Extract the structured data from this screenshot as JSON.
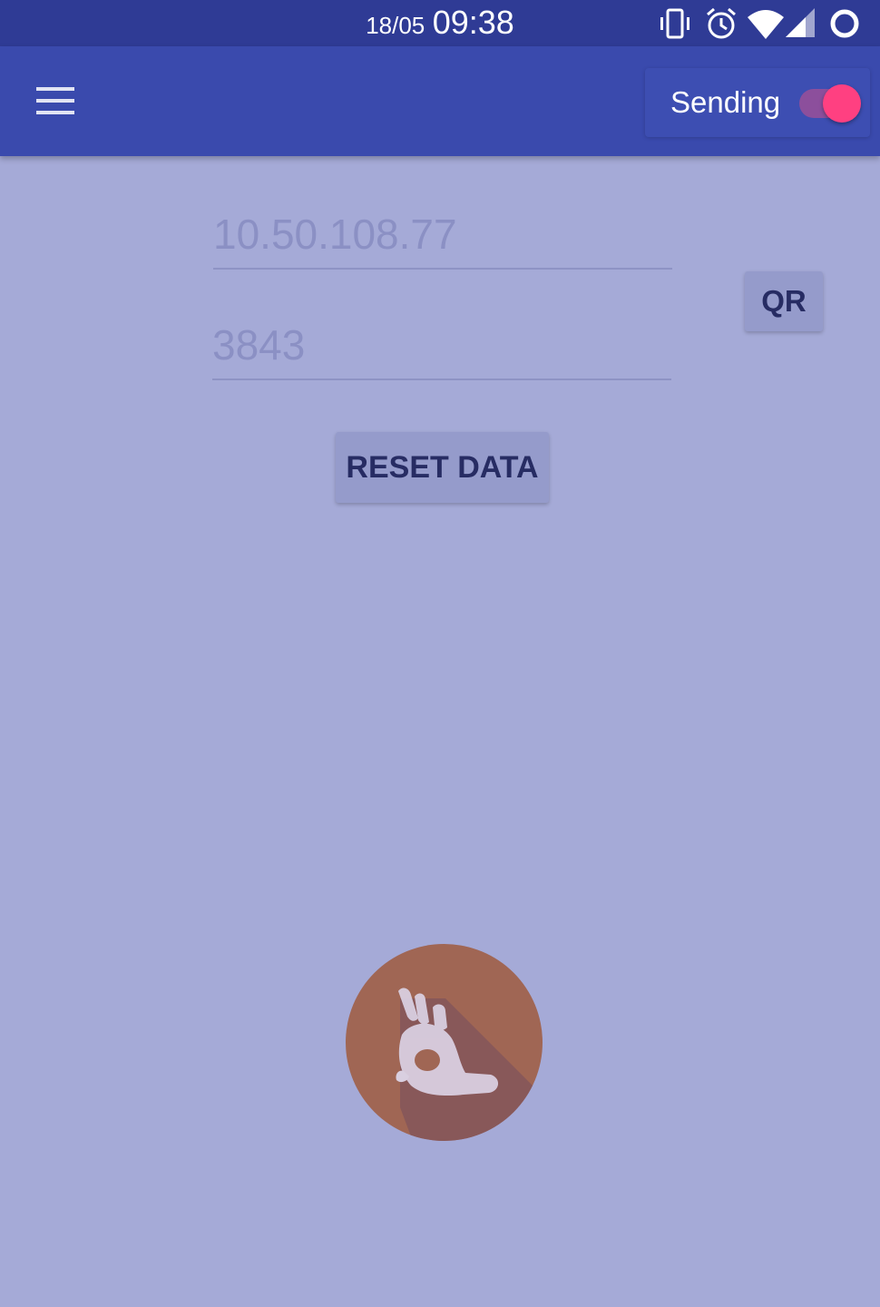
{
  "status_bar": {
    "date": "18/05",
    "time": "09:38",
    "icons": [
      "vibrate-icon",
      "alarm-icon",
      "wifi-icon",
      "cell-signal-icon",
      "battery-ring-icon"
    ]
  },
  "app_bar": {
    "menu_icon": "menu-icon",
    "sending_label": "Sending",
    "sending_enabled": true
  },
  "form": {
    "ip_address": "10.50.108.77",
    "port": "3843",
    "qr_label": "QR",
    "reset_label": "RESET DATA"
  },
  "gesture_badge": {
    "icon": "ok-hand-icon"
  },
  "colors": {
    "background": "#a5aad7",
    "status_bar": "#2f3b95",
    "app_bar": "#3a4aad",
    "toggle_thumb": "#ff4081",
    "badge": "#a06654"
  }
}
